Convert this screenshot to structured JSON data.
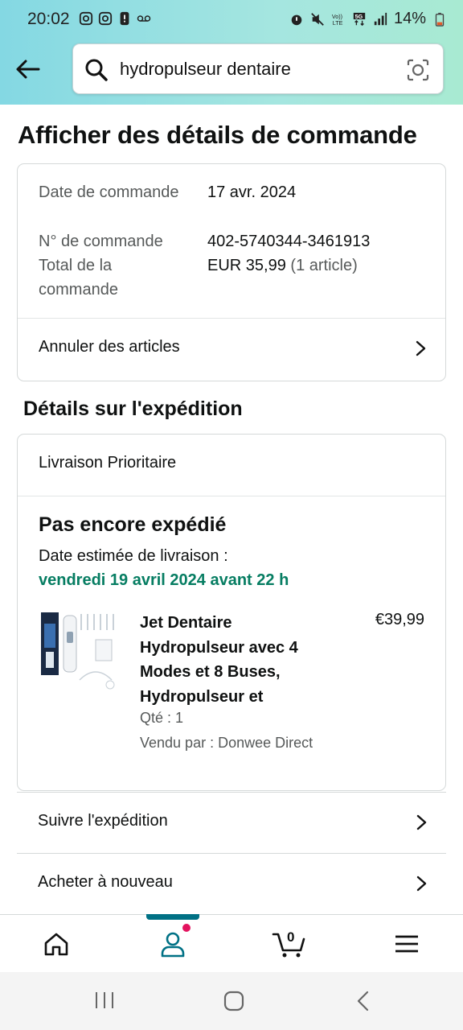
{
  "status_bar": {
    "time": "20:02",
    "battery": "14%",
    "network": "5G"
  },
  "search": {
    "query": "hydropulseur dentaire"
  },
  "page": {
    "title": "Afficher des détails de commande"
  },
  "order_summary": {
    "date_label": "Date de commande",
    "date_value": "17 avr. 2024",
    "number_label": "N° de commande",
    "number_value": "402-5740344-3461913",
    "total_label": "Total de la commande",
    "total_value": "EUR 35,99",
    "total_count": "(1 article)",
    "cancel_label": "Annuler des articles"
  },
  "shipping": {
    "section_title": "Détails sur l'expédition",
    "method": "Livraison Prioritaire",
    "status": "Pas encore expédié",
    "estimate_label": "Date estimée de livraison :",
    "estimate_date": "vendredi 19 avril 2024 avant 22 h",
    "item": {
      "title": "Jet Dentaire Hydropulseur avec 4 Modes et 8 Buses, Hydropulseur et",
      "price": "€39,99",
      "qty": "Qté : 1",
      "seller": "Vendu par : Donwee Direct"
    }
  },
  "actions": {
    "track": "Suivre l'expédition",
    "buy_again": "Acheter à nouveau"
  },
  "bottom_nav": {
    "cart_count": "0",
    "active": "account"
  },
  "colors": {
    "accent_teal": "#007185",
    "delivery_green": "#067d62",
    "notification_pink": "#e3125e"
  }
}
